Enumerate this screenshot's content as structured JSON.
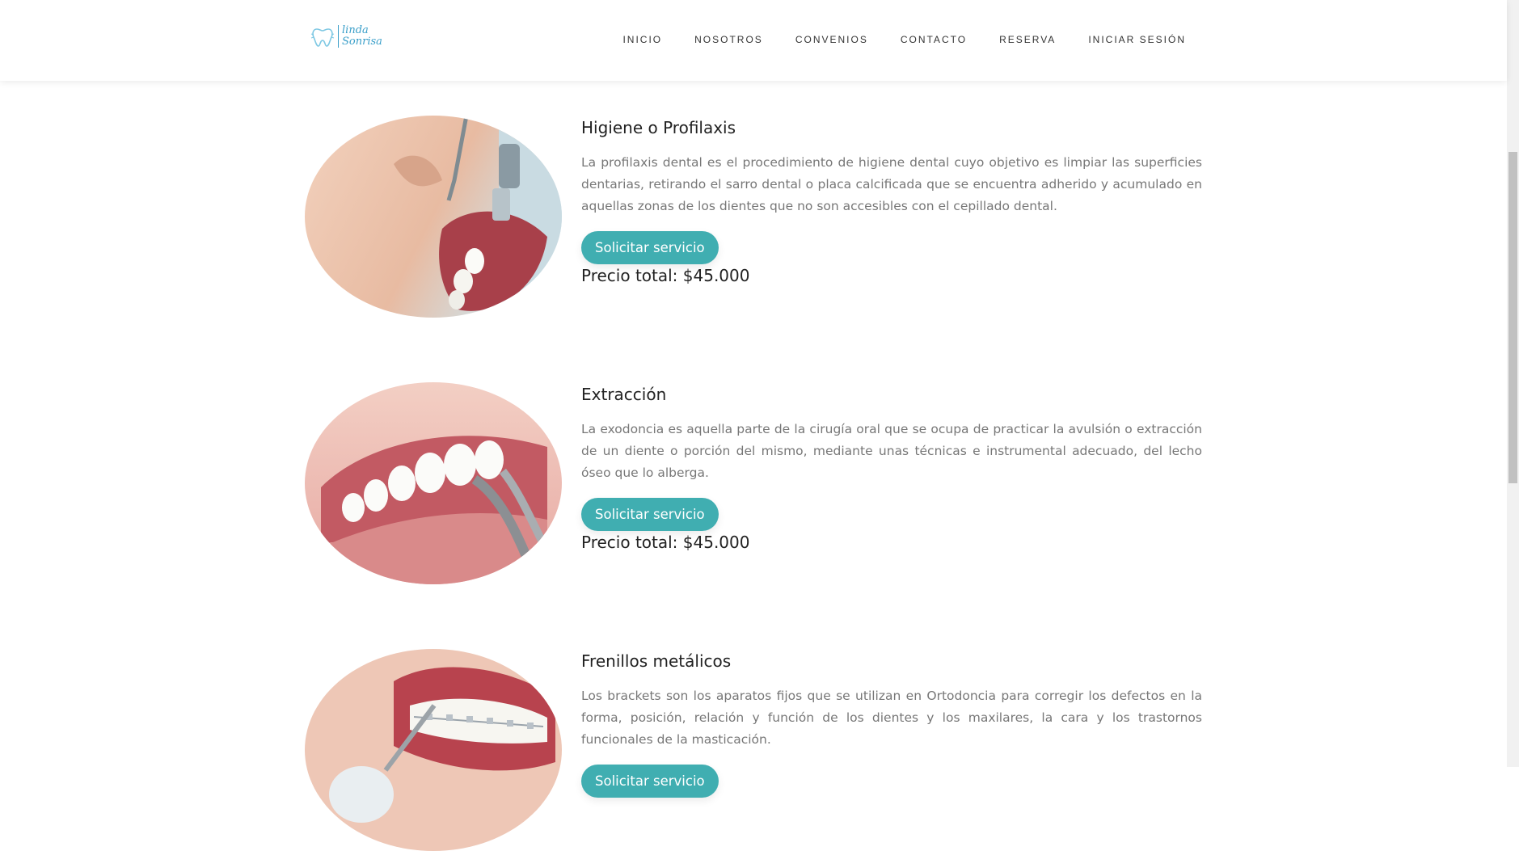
{
  "header": {
    "logo_line1": "linda",
    "logo_line2": "Sonrisa",
    "nav": [
      "INICIO",
      "NOSOTROS",
      "CONVENIOS",
      "CONTACTO",
      "RESERVA",
      "INICIAR SESIÓN"
    ]
  },
  "services": [
    {
      "title": "Higiene o Profilaxis",
      "description": "La profilaxis dental es el procedimiento de higiene dental cuyo objetivo es limpiar las superficies dentarias, retirando el sarro dental o placa calcificada que se encuentra adherido y acumulado en aquellas zonas de los dientes que no son accesibles con el cepillado dental.",
      "button": "Solicitar servicio",
      "price": "Precio total: $45.000"
    },
    {
      "title": "Extracción",
      "description": "La exodoncia es aquella parte de la cirugía oral que se ocupa de practicar la avulsión o extracción de un diente o porción del mismo, mediante unas técnicas e instrumental adecuado, del lecho óseo que lo alberga.",
      "button": "Solicitar servicio",
      "price": "Precio total: $45.000"
    },
    {
      "title": "Frenillos metálicos",
      "description": "Los brackets son los aparatos fijos que se utilizan en Ortodoncia para corregir los defectos en la forma, posición, relación y función de los dientes y los maxilares, la cara y los trastornos funcionales de la masticación.",
      "button": "Solicitar servicio",
      "price": ""
    }
  ],
  "colors": {
    "accent": "#40aeb1",
    "logo": "#3a9fc9"
  }
}
